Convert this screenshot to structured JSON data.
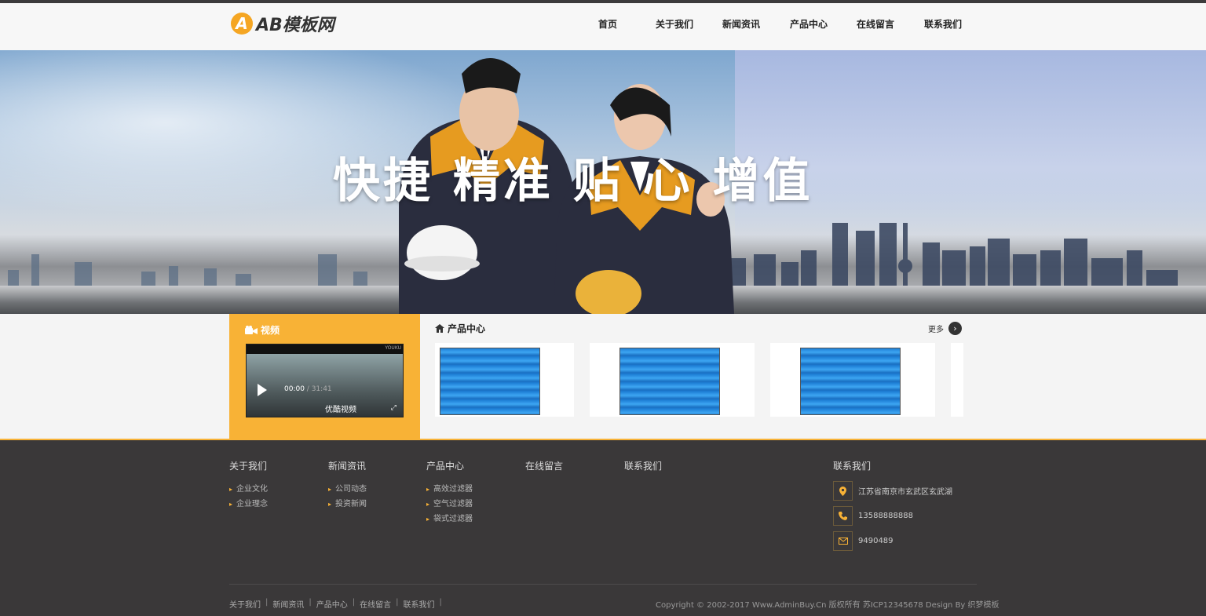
{
  "logo": {
    "badge": "A",
    "text": "AB模板网"
  },
  "nav": [
    {
      "label": "首页"
    },
    {
      "label": "关于我们"
    },
    {
      "label": "新闻资讯"
    },
    {
      "label": "产品中心"
    },
    {
      "label": "在线留言"
    },
    {
      "label": "联系我们"
    }
  ],
  "banner": {
    "slogan": "快捷 精准 贴   心 增值"
  },
  "video": {
    "title": "视频",
    "brand": "YOUKU",
    "time_current": "00:00",
    "time_sep": " / ",
    "time_total": "31:41",
    "player_logo": "优酷视频"
  },
  "products": {
    "title": "产品中心",
    "more_label": "更多",
    "items": [
      "",
      "",
      "",
      ""
    ]
  },
  "footer": {
    "columns": [
      {
        "title": "关于我们",
        "links": [
          "企业文化",
          "企业理念"
        ]
      },
      {
        "title": "新闻资讯",
        "links": [
          "公司动态",
          "投资新闻"
        ]
      },
      {
        "title": "产品中心",
        "links": [
          "高效过滤器",
          "空气过滤器",
          "袋式过滤器"
        ]
      },
      {
        "title": "在线留言",
        "links": []
      },
      {
        "title": "联系我们",
        "links": []
      }
    ],
    "contact": {
      "title": "联系我们",
      "address": "江苏省南京市玄武区玄武湖",
      "phone": "13588888888",
      "fax": "9490489"
    },
    "bottom_links": [
      "关于我们",
      "新闻资讯",
      "产品中心",
      "在线留言",
      "联系我们"
    ],
    "separator": "|",
    "copyright": "Copyright © 2002-2017 Www.AdminBuy.Cn 版权所有 苏ICP12345678 Design By 织梦模板"
  },
  "colors": {
    "accent": "#f8b236",
    "footer_bg": "#3a3839",
    "topline": "#3c3b3c"
  },
  "icons": [
    "video-camera-icon",
    "home-icon",
    "arrow-right-icon",
    "location-pin-icon",
    "phone-icon",
    "mail-icon",
    "play-icon"
  ]
}
